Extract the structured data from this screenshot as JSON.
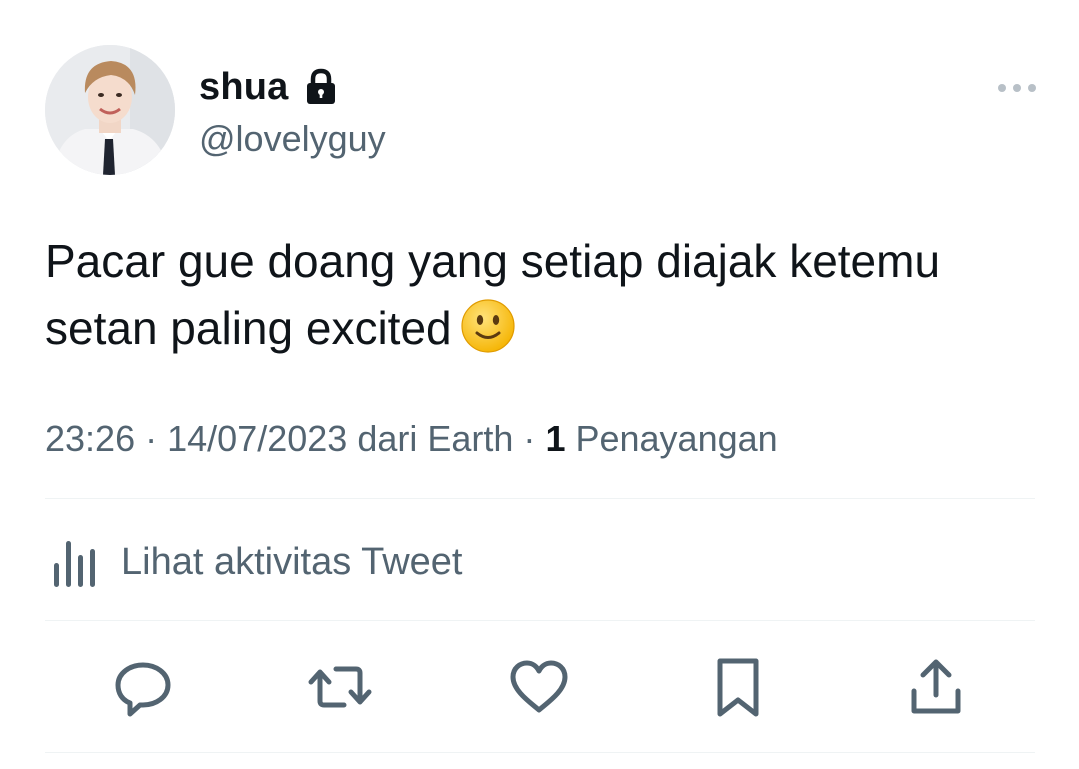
{
  "author": {
    "display_name": "shua",
    "handle": "@lovelyguy",
    "protected_icon": "lock-icon",
    "avatar": "avatar"
  },
  "tweet": {
    "text": "Pacar gue doang yang setiap diajak ketemu setan paling excited",
    "emoji": "slightly-smiling-face-icon"
  },
  "meta": {
    "time": "23:26",
    "separator": "·",
    "date": "14/07/2023",
    "source": "dari Earth",
    "views_count": "1",
    "views_label": "Penayangan"
  },
  "activity": {
    "label": "Lihat aktivitas Tweet",
    "icon": "analytics-icon"
  },
  "actions": [
    {
      "name": "reply",
      "icon": "reply-icon"
    },
    {
      "name": "retweet",
      "icon": "retweet-icon"
    },
    {
      "name": "like",
      "icon": "heart-icon"
    },
    {
      "name": "bookmark",
      "icon": "bookmark-icon"
    },
    {
      "name": "share",
      "icon": "share-icon"
    }
  ],
  "colors": {
    "text_primary": "#0f1419",
    "text_secondary": "#536471",
    "divider": "#eff3f4",
    "emoji_face": "#ffcc4d"
  }
}
